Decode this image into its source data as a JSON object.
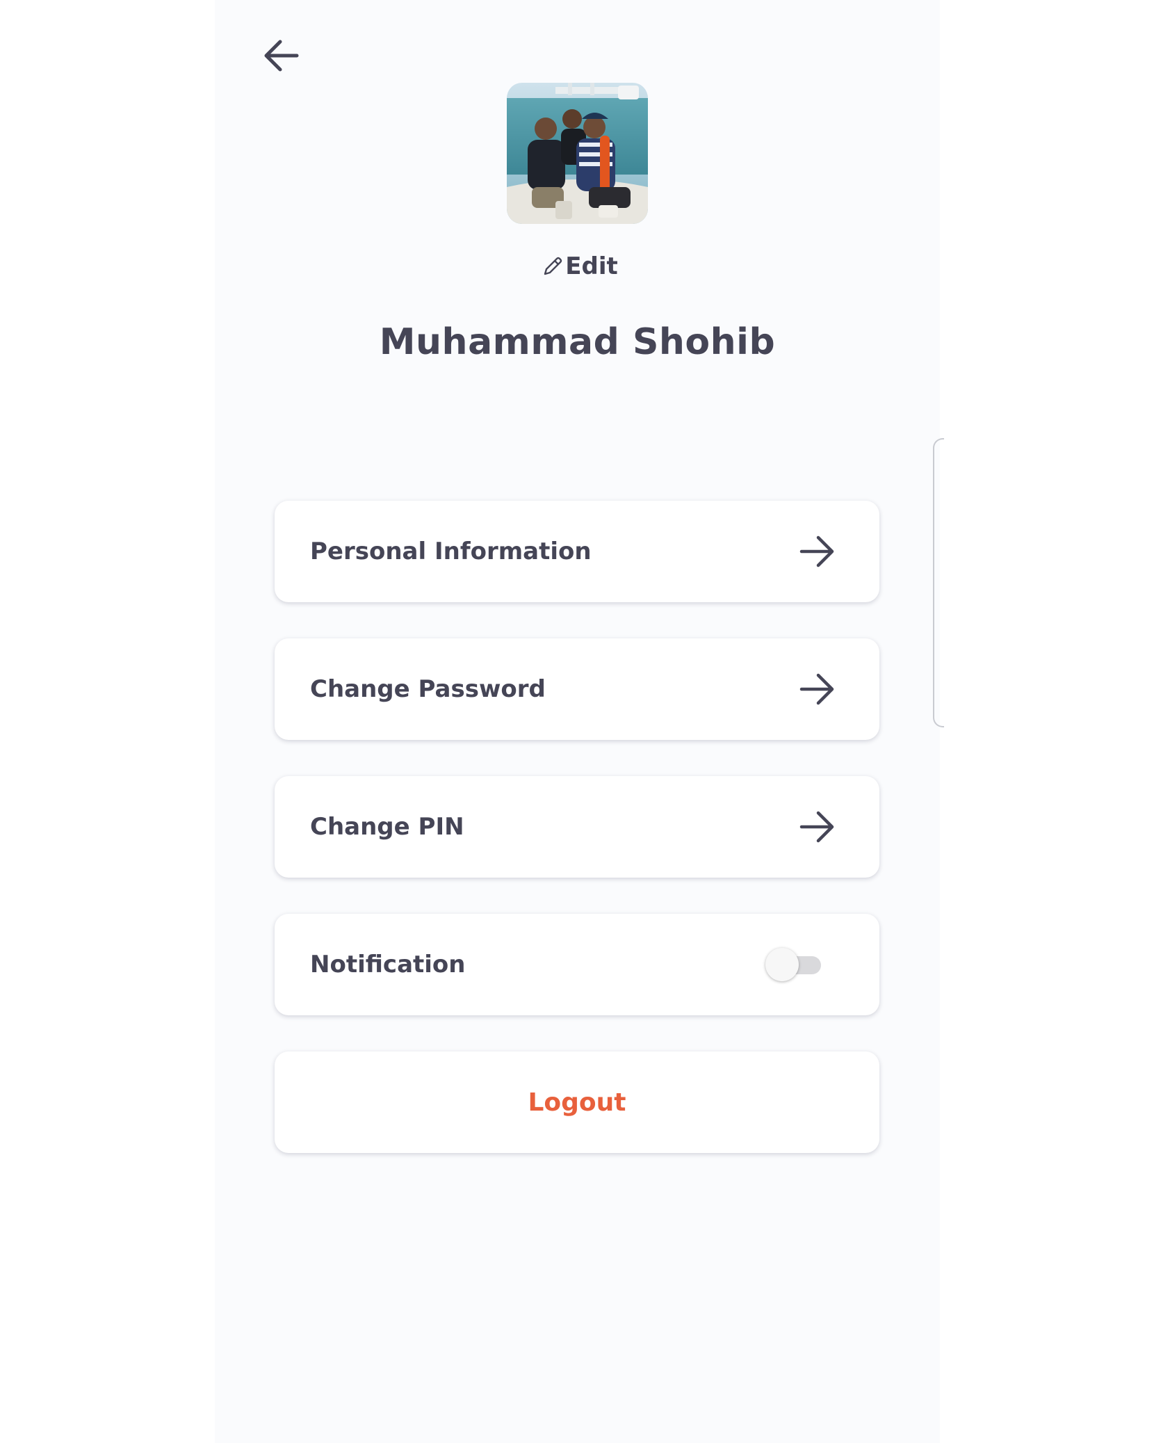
{
  "header": {
    "back_icon": "arrow-left-icon"
  },
  "profile": {
    "avatar_icon": "profile-photo",
    "edit_icon": "pencil-icon",
    "edit_label": "Edit",
    "name": "Muhammad Shohib"
  },
  "menu": {
    "items": [
      {
        "label": "Personal Information",
        "icon": "arrow-right-icon"
      },
      {
        "label": "Change Password",
        "icon": "arrow-right-icon"
      },
      {
        "label": "Change PIN",
        "icon": "arrow-right-icon"
      }
    ],
    "notification": {
      "label": "Notification",
      "enabled": false
    },
    "logout_label": "Logout"
  },
  "colors": {
    "text": "#454556",
    "logout": "#e8603c",
    "background": "#fafbfd",
    "card": "#ffffff"
  }
}
